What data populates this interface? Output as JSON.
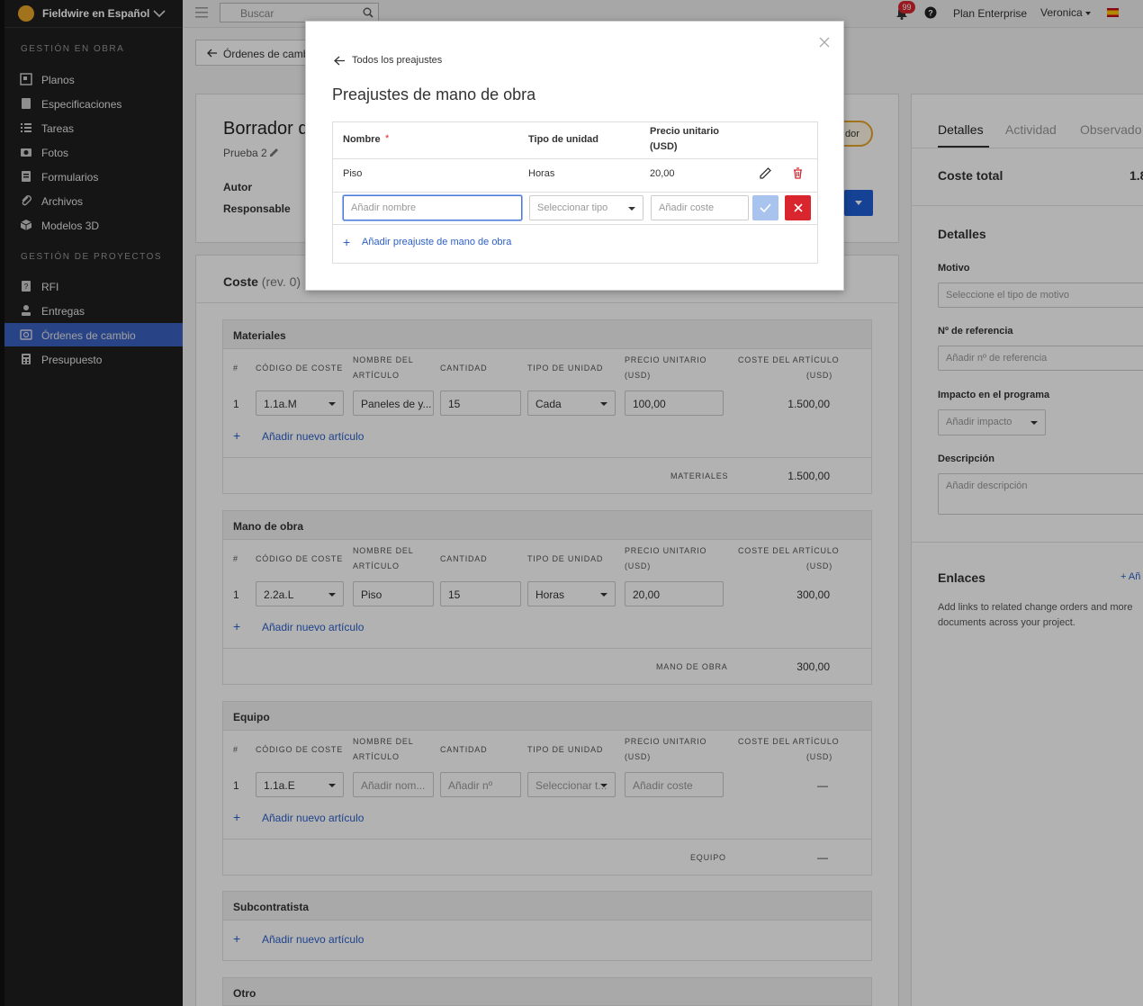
{
  "sidebar": {
    "brand": "Fieldwire en Español",
    "section1": "GESTIÓN EN OBRA",
    "section2": "GESTIÓN DE PROYECTOS",
    "items1": [
      {
        "label": "Planos",
        "icon": "plans-icon"
      },
      {
        "label": "Especificaciones",
        "icon": "specs-icon"
      },
      {
        "label": "Tareas",
        "icon": "tasks-icon"
      },
      {
        "label": "Fotos",
        "icon": "camera-icon"
      },
      {
        "label": "Formularios",
        "icon": "forms-icon"
      },
      {
        "label": "Archivos",
        "icon": "paperclip-icon"
      },
      {
        "label": "Modelos 3D",
        "icon": "cube-icon"
      }
    ],
    "items2": [
      {
        "label": "RFI",
        "icon": "rfi-icon"
      },
      {
        "label": "Entregas",
        "icon": "submittal-icon"
      },
      {
        "label": "Órdenes de cambio",
        "icon": "change-order-icon",
        "active": true
      },
      {
        "label": "Presupuesto",
        "icon": "calculator-icon"
      }
    ]
  },
  "topbar": {
    "search_placeholder": "Buscar",
    "notifications": "99",
    "plan": "Plan Enterprise",
    "user": "Veronica"
  },
  "page": {
    "back_label": "Órdenes de cambi",
    "title": "Borrador de",
    "subtitle": "Prueba 2",
    "autor_label": "Autor",
    "responsable_label": "Responsable",
    "status_partial": "dor",
    "cost_title": "Coste",
    "cost_rev": "(rev. 0)"
  },
  "columns": {
    "num": "#",
    "code": "CÓDIGO DE COSTE",
    "name1": "NOMBRE DEL",
    "name2": "ARTÍCULO",
    "qty": "CANTIDAD",
    "unit": "TIPO DE UNIDAD",
    "price1": "PRECIO UNITARIO",
    "price2": "(USD)",
    "cost1": "COSTE DEL ARTÍCULO",
    "cost2": "(USD)"
  },
  "add_item": "Añadir nuevo artículo",
  "materiales": {
    "title": "Materiales",
    "row": {
      "num": "1",
      "code": "1.1a.M",
      "name": "Paneles de y...",
      "qty": "15",
      "unit": "Cada",
      "price": "100,00",
      "cost": "1.500,00"
    },
    "total_label": "MATERIALES",
    "total": "1.500,00"
  },
  "mano": {
    "title": "Mano de obra",
    "row": {
      "num": "1",
      "code": "2.2a.L",
      "name": "Piso",
      "qty": "15",
      "unit": "Horas",
      "price": "20,00",
      "cost": "300,00"
    },
    "total_label": "MANO DE OBRA",
    "total": "300,00"
  },
  "equipo": {
    "title": "Equipo",
    "row": {
      "num": "1",
      "code": "1.1a.E",
      "name": "Añadir nom...",
      "qty": "Añadir nº",
      "unit": "Seleccionar t...",
      "price": "Añadir coste",
      "cost": "—"
    },
    "total_label": "EQUIPO",
    "total": "—"
  },
  "subcontratista": {
    "title": "Subcontratista"
  },
  "otro": {
    "title": "Otro"
  },
  "right": {
    "tabs": [
      "Detalles",
      "Actividad",
      "Observado"
    ],
    "coste_total_label": "Coste total",
    "coste_total_value": "1.8",
    "detalles_title": "Detalles",
    "motivo_label": "Motivo",
    "motivo_placeholder": "Seleccione el tipo de motivo",
    "ref_label": "Nº de referencia",
    "ref_placeholder": "Añadir nº de referencia",
    "impacto_label": "Impacto en el programa",
    "impacto_placeholder": "Añadir impacto",
    "desc_label": "Descripción",
    "desc_placeholder": "Añadir descripción",
    "enlaces_title": "Enlaces",
    "enlaces_add": "+ Añ",
    "enlaces_text_1": "Add links to related change orders and more",
    "enlaces_text_2": "documents across your project."
  },
  "modal": {
    "back": "Todos los preajustes",
    "title": "Preajustes de mano de obra",
    "col_name": "Nombre",
    "required_mark": "*",
    "col_unit": "Tipo de unidad",
    "col_price_1": "Precio unitario",
    "col_price_2": "(USD)",
    "row": {
      "name": "Piso",
      "unit": "Horas",
      "price": "20,00"
    },
    "name_placeholder": "Añadir nombre",
    "unit_placeholder": "Seleccionar tipo",
    "price_placeholder": "Añadir coste",
    "add_label": "Añadir preajuste de mano de obra"
  },
  "colors": {
    "sidebar_bg": "#1f1f1f",
    "active_item": "#3a62c2",
    "link": "#2b5fc9",
    "delete_red": "#d9262e",
    "confirm_blue": "#a9c3ef",
    "primary_button": "#1f5fd6",
    "status_yellow": "#e8a52a"
  }
}
